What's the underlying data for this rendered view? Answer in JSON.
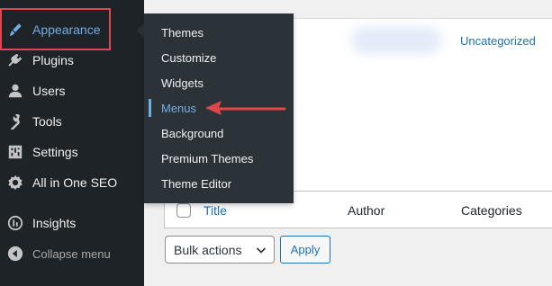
{
  "sidebar": {
    "items": [
      {
        "label": "Appearance",
        "icon": "paintbrush-icon"
      },
      {
        "label": "Plugins",
        "icon": "plugin-icon"
      },
      {
        "label": "Users",
        "icon": "user-icon"
      },
      {
        "label": "Tools",
        "icon": "wrench-icon"
      },
      {
        "label": "Settings",
        "icon": "settings-icon"
      },
      {
        "label": "All in One SEO",
        "icon": "seo-gear-icon"
      },
      {
        "label": "Insights",
        "icon": "insights-icon"
      },
      {
        "label": "Collapse menu",
        "icon": "collapse-icon"
      }
    ]
  },
  "flyout": {
    "items": [
      {
        "label": "Themes"
      },
      {
        "label": "Customize"
      },
      {
        "label": "Widgets"
      },
      {
        "label": "Menus"
      },
      {
        "label": "Background"
      },
      {
        "label": "Premium Themes"
      },
      {
        "label": "Theme Editor"
      }
    ]
  },
  "main": {
    "category_link": "Uncategorized"
  },
  "table": {
    "columns": {
      "title": "Title",
      "author": "Author",
      "categories": "Categories"
    }
  },
  "actions": {
    "bulk_select": "Bulk actions",
    "apply": "Apply"
  },
  "colors": {
    "sidebar_bg": "#1d2327",
    "flyout_bg": "#2c3338",
    "accent": "#72aee6",
    "link": "#2271b1",
    "highlight": "#e0474c"
  }
}
